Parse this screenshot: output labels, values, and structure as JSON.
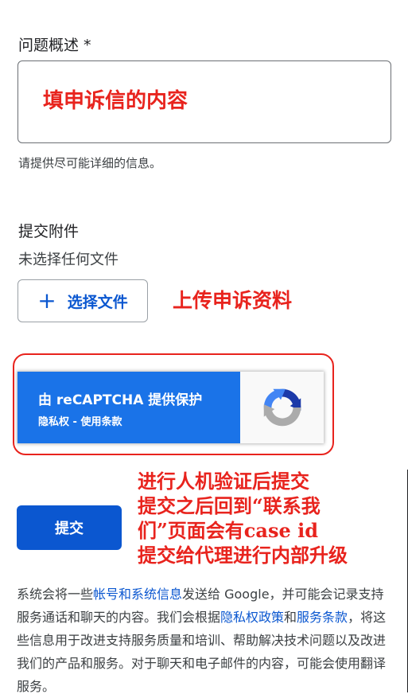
{
  "description_field": {
    "label": "问题概述 *",
    "annotation": "填申诉信的内容",
    "hint": "请提供尽可能详细的信息。"
  },
  "attachment": {
    "label": "提交附件",
    "status": "未选择任何文件",
    "choose_button_icon": "+",
    "choose_button_label": "选择文件",
    "annotation": "上传申诉资料"
  },
  "recaptcha": {
    "title": "由 reCAPTCHA 提供保护",
    "privacy_link": "隐私权",
    "separator": " - ",
    "terms_link": "使用条款",
    "logo_icon": "recaptcha-logo-icon"
  },
  "submit": {
    "label": "提交",
    "annotation_lines": [
      "进行人机验证后提交",
      "提交之后回到“联系我",
      "们”页面会有case id",
      "提交给代理进行内部升级"
    ]
  },
  "disclaimer": {
    "part1": "系统会将一些",
    "link_account": "帐号和系统信息",
    "part2": "发送给 Google，并可能会记录支持服务通话和聊天的内容。我们会根据",
    "link_privacy": "隐私权政策",
    "part3": "和",
    "link_terms": "服务条款",
    "part4": "，将这些信息用于改进支持服务质量和培训、帮助解决技术问题以及改进我们的产品和服务。对于聊天和电子邮件的内容，可能会使用翻译服务。"
  },
  "colors": {
    "annotation_red": "#e8231d",
    "primary_blue": "#0b57d0",
    "recaptcha_blue": "#1a73e8"
  }
}
